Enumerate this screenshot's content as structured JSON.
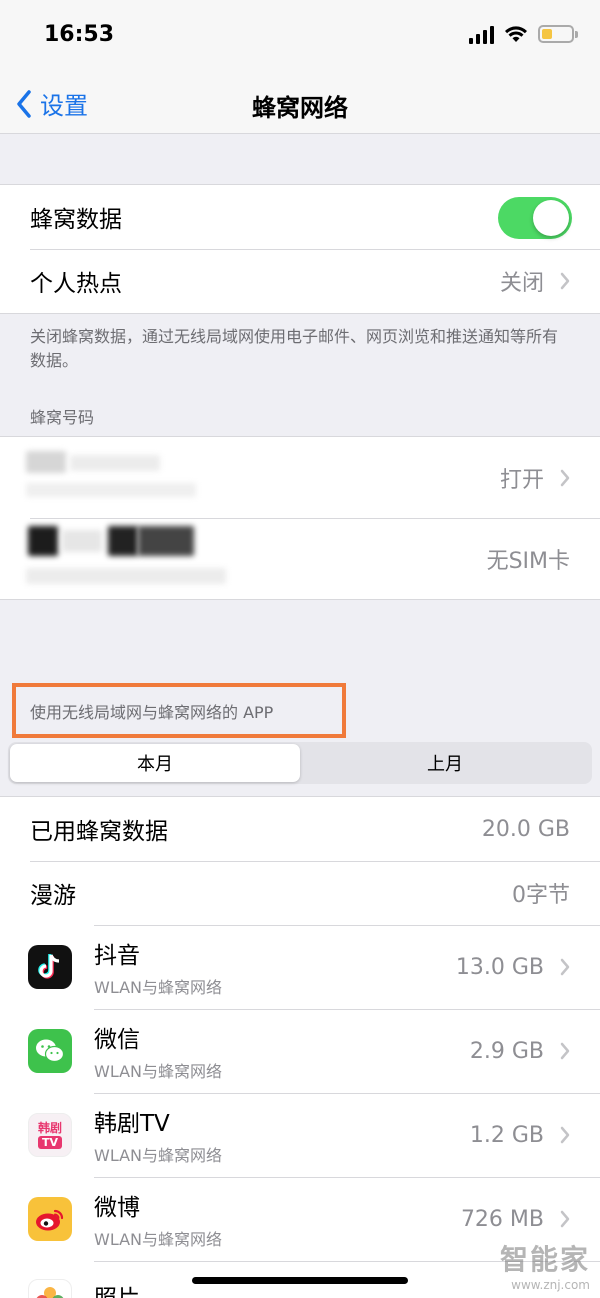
{
  "status": {
    "time": "16:53"
  },
  "nav": {
    "back_label": "设置",
    "title": "蜂窝网络"
  },
  "cellular": {
    "data_label": "蜂窝数据",
    "data_enabled": true,
    "hotspot_label": "个人热点",
    "hotspot_value": "关闭",
    "footnote": "关闭蜂窝数据，通过无线局域网使用电子邮件、网页浏览和推送通知等所有数据。"
  },
  "numbers": {
    "header": "蜂窝号码",
    "rows": [
      {
        "value": "打开"
      },
      {
        "value": "无SIM卡"
      }
    ]
  },
  "apps_section": {
    "header": "使用无线局域网与蜂窝网络的 APP",
    "tabs": [
      {
        "label": "本月",
        "active": true
      },
      {
        "label": "上月",
        "active": false
      }
    ],
    "used_label": "已用蜂窝数据",
    "used_value": "20.0 GB",
    "roaming_label": "漫游",
    "roaming_value": "0字节",
    "apps": [
      {
        "name": "抖音",
        "sub": "WLAN与蜂窝网络",
        "value": "13.0 GB",
        "icon": "douyin-icon",
        "color": "#111111"
      },
      {
        "name": "微信",
        "sub": "WLAN与蜂窝网络",
        "value": "2.9 GB",
        "icon": "wechat-icon",
        "color": "#3ec24c"
      },
      {
        "name": "韩剧TV",
        "sub": "WLAN与蜂窝网络",
        "value": "1.2 GB",
        "icon": "hanju-tv-icon",
        "color": "#f2f2f2",
        "icon_text": "韩剧",
        "icon_text_2": "TV"
      },
      {
        "name": "微博",
        "sub": "WLAN与蜂窝网络",
        "value": "726 MB",
        "icon": "weibo-icon",
        "color": "#f8c23a"
      },
      {
        "name": "照片",
        "icon": "photos-icon"
      }
    ]
  },
  "watermark": {
    "main": "智能家",
    "url": "www.znj.com"
  }
}
